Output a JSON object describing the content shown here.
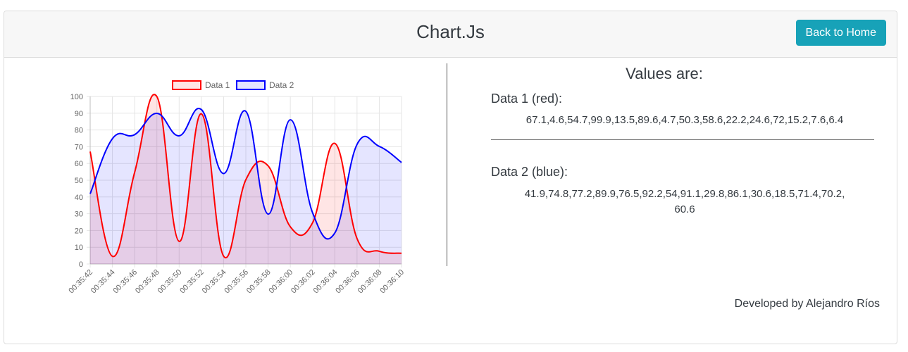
{
  "header": {
    "title": "Chart.Js",
    "back_button_label": "Back to Home"
  },
  "values_panel": {
    "title": "Values are:",
    "data1_label": "Data 1 (red):",
    "data1_values": "67.1,4.6,54.7,99.9,13.5,89.6,4.7,50.3,58.6,22.2,24.6,72,15.2,7.6,6.4",
    "data2_label": "Data 2 (blue):",
    "data2_values": "41.9,74.8,77.2,89.9,76.5,92.2,54,91.1,29.8,86.1,30.6,18.5,71.4,70.2,\n60.6"
  },
  "footer": {
    "credit": "Developed by Alejandro Ríos"
  },
  "colors": {
    "accent": "#17a2b8",
    "series1_line": "#ff0000",
    "series1_fill": "rgba(255,0,0,0.1)",
    "series2_line": "#0000ff",
    "series2_fill": "rgba(0,0,255,0.1)",
    "grid": "#e5e5e5"
  },
  "chart_data": {
    "type": "line",
    "x": [
      "00:35:42",
      "00:35:44",
      "00:35:46",
      "00:35:48",
      "00:35:50",
      "00:35:52",
      "00:35:54",
      "00:35:56",
      "00:35:58",
      "00:36:00",
      "00:36:02",
      "00:36:04",
      "00:36:06",
      "00:36:08",
      "00:36:10"
    ],
    "series": [
      {
        "name": "Data 1",
        "values": [
          67.1,
          4.6,
          54.7,
          99.9,
          13.5,
          89.6,
          4.7,
          50.3,
          58.6,
          22.2,
          24.6,
          72,
          15.2,
          7.6,
          6.4
        ]
      },
      {
        "name": "Data 2",
        "values": [
          41.9,
          74.8,
          77.2,
          89.9,
          76.5,
          92.2,
          54,
          91.1,
          29.8,
          86.1,
          30.6,
          18.5,
          71.4,
          70.2,
          60.6
        ]
      }
    ],
    "y_ticks": [
      "0",
      "10",
      "20",
      "30",
      "40",
      "50",
      "60",
      "70",
      "80",
      "90",
      "100"
    ],
    "ylim": [
      0,
      100
    ],
    "grid": true,
    "legend": "top-center",
    "fill": true,
    "smooth": true
  }
}
